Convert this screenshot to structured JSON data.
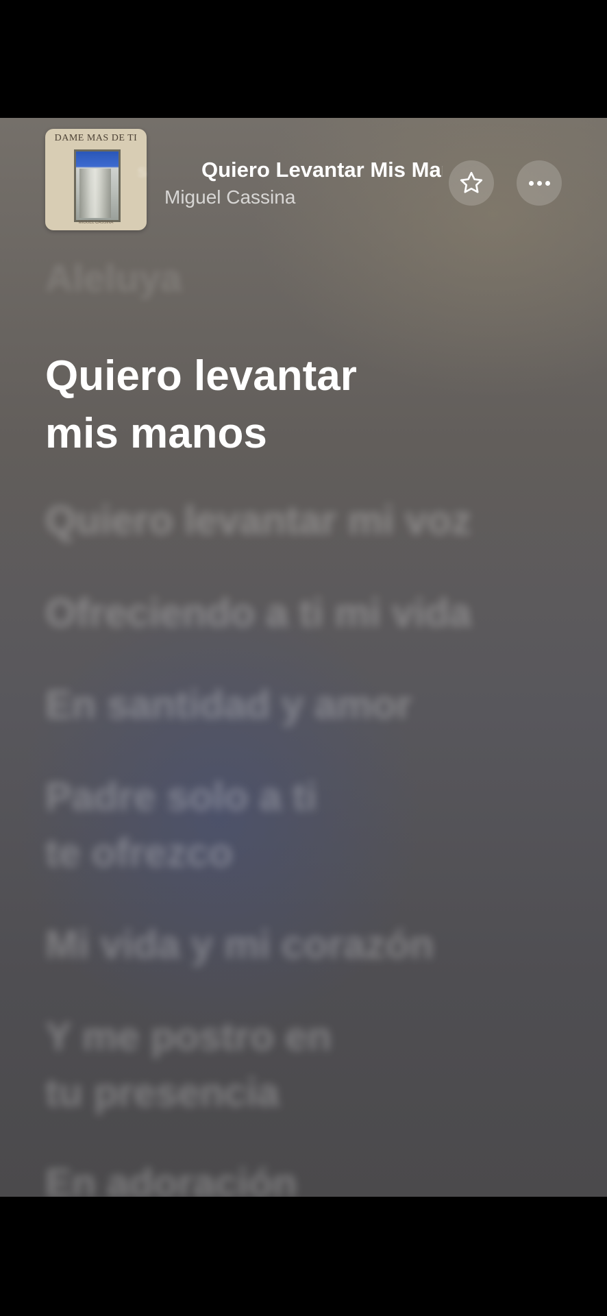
{
  "now_playing": {
    "song_title": "Quiero Levantar Mis Manos",
    "artist": "Miguel Cassina",
    "album_art": {
      "title": "DAME MAS DE TI",
      "subtitle": "MIGUEL CASSINA",
      "icon": "album-art"
    },
    "ghost_text": "s"
  },
  "buttons": {
    "favorite_icon": "star-icon",
    "more_icon": "ellipsis-icon"
  },
  "lyrics": {
    "previous_line": "Aleluya",
    "current_line_1": "Quiero levantar",
    "current_line_2": "mis manos",
    "upcoming": [
      "Quiero levantar mi voz",
      "Ofreciendo a ti mi vida",
      "En santidad y amor",
      "Padre solo a ti",
      "te ofrezco",
      "Mi vida y mi corazón",
      "Y me postro en",
      "tu presencia",
      "En adoración"
    ]
  },
  "colors": {
    "background_top": "#75706a",
    "background_bottom": "#4b4a4c",
    "accent_text": "#ffffff"
  }
}
